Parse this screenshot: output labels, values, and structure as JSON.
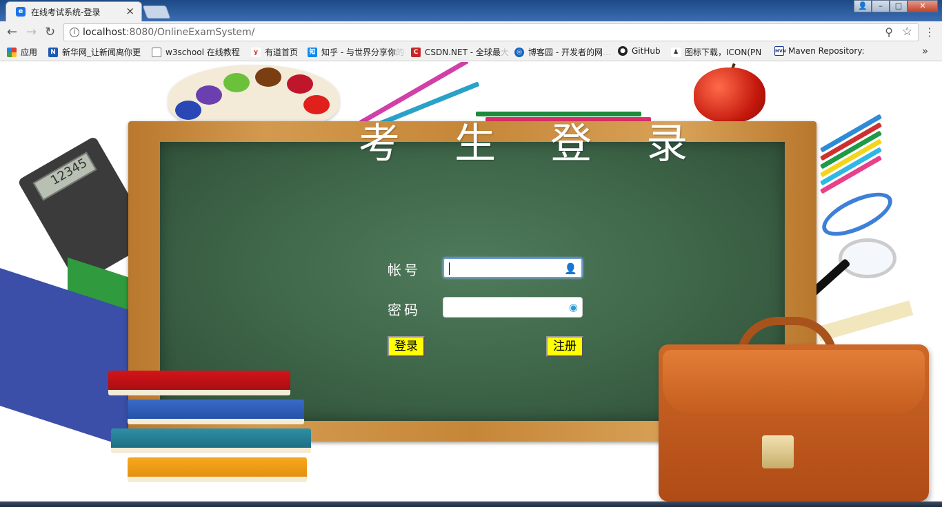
{
  "browser": {
    "tab_title": "在线考试系统-登录",
    "tab_close": "×",
    "url_host": "localhost",
    "url_path": ":8080/OnlineExamSystem/",
    "bookmarks": [
      {
        "label": "应用",
        "fade": "",
        "icon": "apps-grid-icon"
      },
      {
        "label": "新华网_让新闻离你更",
        "fade": "",
        "icon": "news-icon"
      },
      {
        "label": "w3school 在线教程",
        "fade": "",
        "icon": "page-icon"
      },
      {
        "label": "有道首页",
        "fade": "",
        "icon": "youdao-icon"
      },
      {
        "label": "知乎 - 与世界分享你",
        "fade": "的",
        "icon": "zhihu-icon"
      },
      {
        "label": "CSDN.NET - 全球最",
        "fade": "大",
        "icon": "csdn-icon"
      },
      {
        "label": "博客园 - 开发者的网",
        "fade": "…",
        "icon": "cnblogs-icon"
      },
      {
        "label": "GitHub",
        "fade": "",
        "icon": "github-icon"
      },
      {
        "label": "图标下载，ICON(PN",
        "fade": "",
        "icon": "iconfont-icon"
      },
      {
        "label": "Maven Repository:",
        "fade": "",
        "icon": "maven-icon"
      }
    ],
    "more_bookmarks": "»"
  },
  "login": {
    "heading": "考 生 登 录",
    "account_label": "帐号",
    "password_label": "密码",
    "account_value": "",
    "password_value": "",
    "login_button": "登录",
    "register_button": "注册"
  },
  "decor": {
    "calculator_display": "12345"
  },
  "colors": {
    "chalkboard": "#3d6447",
    "frame": "#c68638",
    "button": "#ffff00"
  }
}
